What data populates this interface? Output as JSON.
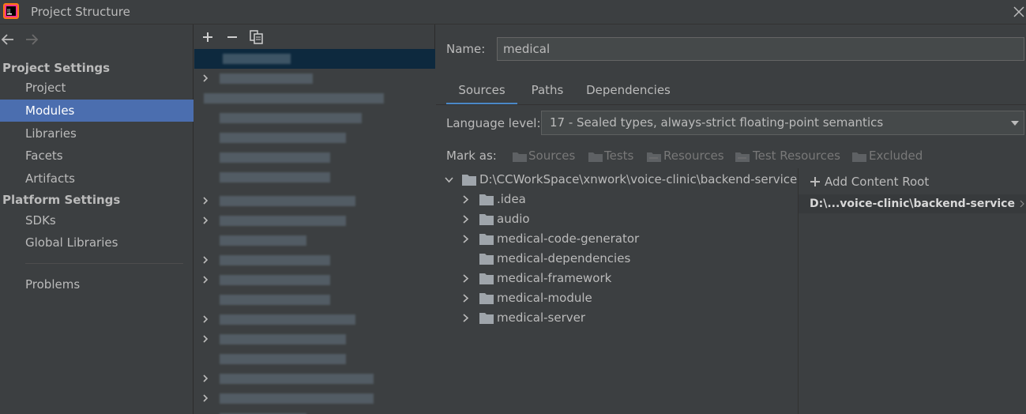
{
  "window": {
    "title": "Project Structure",
    "logo_text": "IJ"
  },
  "nav": {
    "project_settings_title": "Project Settings",
    "project_settings_items": [
      "Project",
      "Modules",
      "Libraries",
      "Facets",
      "Artifacts"
    ],
    "platform_settings_title": "Platform Settings",
    "platform_settings_items": [
      "SDKs",
      "Global Libraries"
    ],
    "problems": "Problems",
    "selected": "Modules"
  },
  "module_toolbar": {
    "add": "+",
    "remove": "−",
    "copy": "copy"
  },
  "module": {
    "name_label": "Name:",
    "name_value": "medical",
    "tabs": [
      "Sources",
      "Paths",
      "Dependencies"
    ],
    "active_tab": "Sources",
    "language_label": "Language level:",
    "language_value": "17 - Sealed types, always-strict floating-point semantics",
    "mark_as_label": "Mark as:",
    "mark_as_options": [
      "Sources",
      "Tests",
      "Resources",
      "Test Resources",
      "Excluded"
    ],
    "tree_root": "D:\\CCWorkSpace\\xnwork\\voice-clinic\\backend-service",
    "tree_children": [
      ".idea",
      "audio",
      "medical-code-generator",
      "medical-dependencies",
      "medical-framework",
      "medical-module",
      "medical-server"
    ],
    "add_content_root": "Add Content Root",
    "content_root": "D:\\...voice-clinic\\backend-service"
  },
  "colors": {
    "accent": "#4b6eaf",
    "background": "#3c3f41",
    "tab_underline": "#4a88c7"
  }
}
